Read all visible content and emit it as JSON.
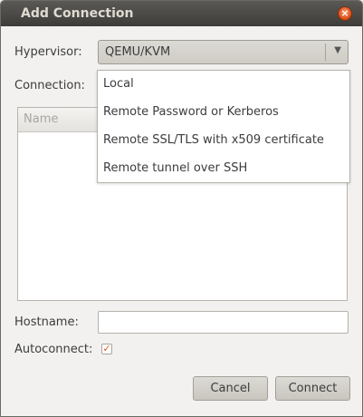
{
  "window": {
    "title": "Add Connection",
    "close_glyph": "×"
  },
  "form": {
    "hypervisor_label": "Hypervisor:",
    "hypervisor_value": "QEMU/KVM",
    "hypervisor_arrow": "▼",
    "connection_label": "Connection:",
    "hostname_label": "Hostname:",
    "hostname_value": "",
    "autoconnect_label": "Autoconnect:",
    "autoconnect_checked": true,
    "autoconnect_glyph": "✓"
  },
  "connection_options": [
    "Local",
    "Remote Password or Kerberos",
    "Remote SSL/TLS with x509 certificate",
    "Remote tunnel over SSH"
  ],
  "tree": {
    "column_name": "Name"
  },
  "buttons": {
    "cancel": "Cancel",
    "connect": "Connect"
  },
  "colors": {
    "accent": "#e2541b",
    "titlebar": "#3d3c38"
  }
}
